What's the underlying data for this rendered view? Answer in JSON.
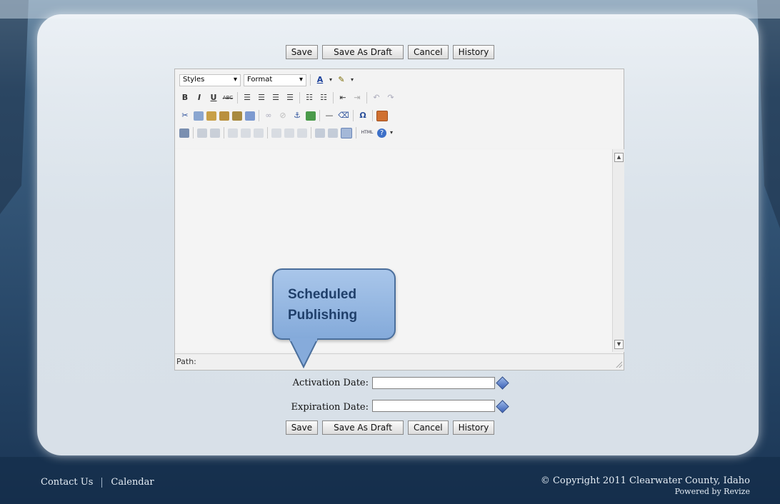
{
  "top_buttons": {
    "save": "Save",
    "save_draft": "Save As Draft",
    "cancel": "Cancel",
    "history": "History"
  },
  "editor": {
    "styles_select": "Styles",
    "format_select": "Format",
    "toolbar_row2": [
      "B",
      "I",
      "U",
      "ABC"
    ],
    "omega": "Ω",
    "html_label": "HTML",
    "path_label": "Path:"
  },
  "callout": {
    "line1": "Scheduled",
    "line2": "Publishing"
  },
  "dates": {
    "activation_label": "Activation Date:",
    "activation_value": "",
    "expiration_label": "Expiration Date:",
    "expiration_value": ""
  },
  "bottom_buttons": {
    "save": "Save",
    "save_draft": "Save As Draft",
    "cancel": "Cancel",
    "history": "History"
  },
  "footer": {
    "contact": "Contact Us",
    "calendar": "Calendar",
    "copyright": "© Copyright 2011 Clearwater County, Idaho",
    "powered": "Powered by Revize"
  },
  "colors": {
    "callout_fill": "#93b5e0",
    "callout_border": "#4b6f9c",
    "background": "#2a4a6b"
  }
}
